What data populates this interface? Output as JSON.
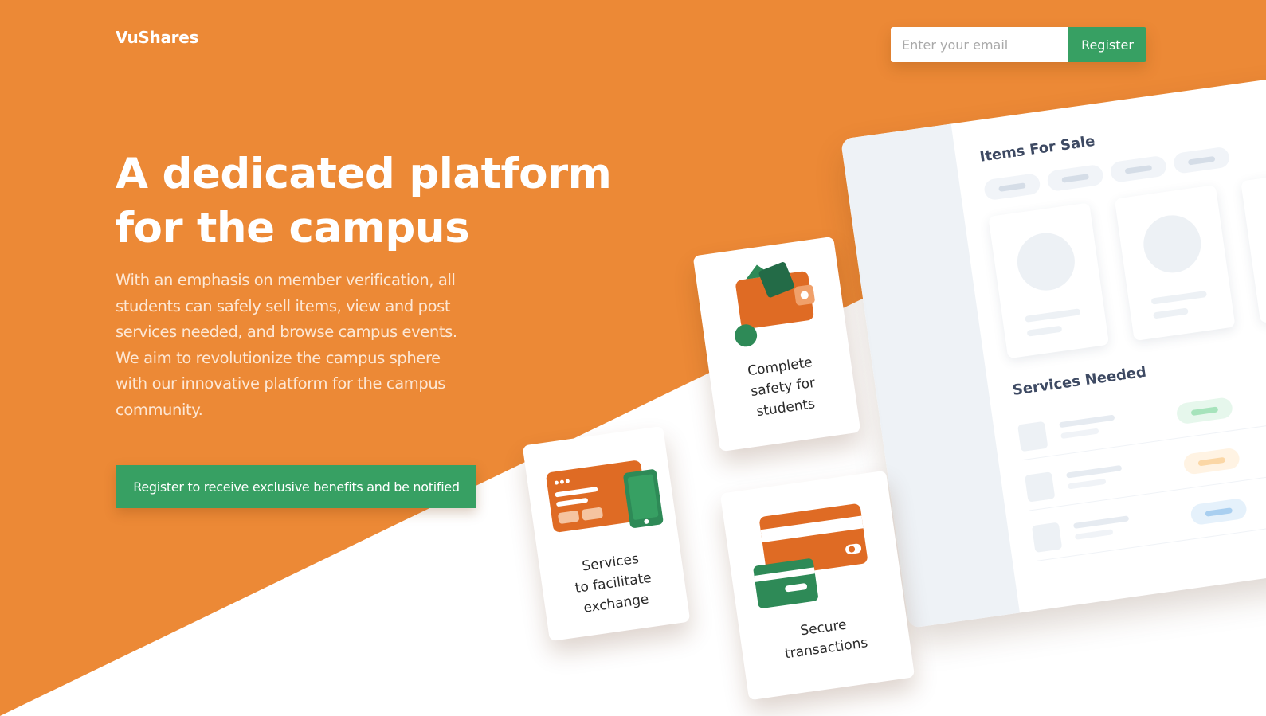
{
  "header": {
    "logo": "VuShares",
    "email_placeholder": "Enter your email",
    "register_label": "Register"
  },
  "hero": {
    "headline": "A dedicated platform for the campus",
    "description": "With an emphasis on member verification, all students can safely sell items, view and post services needed, and browse campus events. We aim to revolutionize the campus sphere with our innovative platform for the campus community.",
    "cta_label": "Register to receive exclusive benefits and be notified"
  },
  "dashboard": {
    "items_title": "Items For Sale",
    "services_title": "Services Needed"
  },
  "features": [
    {
      "label": "Complete\nsafety for\nstudents",
      "icon": "wallet-icon"
    },
    {
      "label": "Services\nto facilitate\nexchange",
      "icon": "card-phone-icon"
    },
    {
      "label": "Secure\ntransactions",
      "icon": "credit-cards-icon"
    }
  ],
  "colors": {
    "hero_background": "#EC8936",
    "accent_green": "#37A063",
    "icon_orange": "#DF6B24",
    "icon_green": "#2E8A57",
    "icon_dark_green": "#236B47"
  }
}
